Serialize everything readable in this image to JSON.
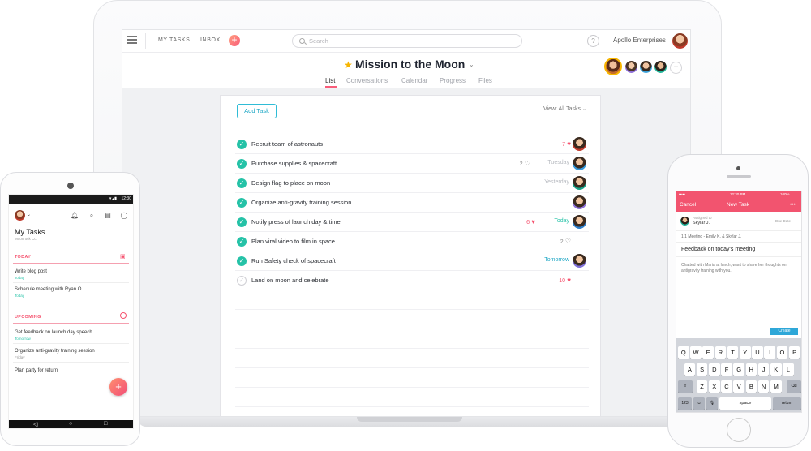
{
  "laptop": {
    "nav": {
      "my_tasks": "MY TASKS",
      "inbox": "INBOX",
      "plus": "+"
    },
    "search_placeholder": "Search",
    "help": "?",
    "org_name": "Apollo Enterprises",
    "project": {
      "title": "Mission to the Moon",
      "tabs": [
        "List",
        "Conversations",
        "Calendar",
        "Progress",
        "Files"
      ],
      "active_tab": "List"
    },
    "member_add": "+",
    "toolbar": {
      "add_task": "Add Task",
      "view_all": "View: All Tasks"
    },
    "tasks": [
      {
        "name": "Recruit team of astronauts",
        "likes": "7",
        "liked": true,
        "due": "",
        "done": true,
        "avatar": "#c0392b"
      },
      {
        "name": "Purchase supplies & spacecraft",
        "likes": "2",
        "liked": false,
        "due": "Tuesday",
        "done": true,
        "avatar": "#3498db"
      },
      {
        "name": "Design flag to place on moon",
        "likes": "",
        "liked": false,
        "due": "Yesterday",
        "done": true,
        "avatar": "#16a085"
      },
      {
        "name": "Organize anti-gravity training session",
        "likes": "",
        "liked": false,
        "due": "",
        "done": true,
        "avatar": "#8e6fd8"
      },
      {
        "name": "Notify press of launch day & time",
        "likes": "6",
        "liked": true,
        "due": "Today",
        "done": true,
        "avatar": "#2d7dc9"
      },
      {
        "name": "Plan viral video to film in space",
        "likes": "2",
        "liked": false,
        "due": "",
        "done": true,
        "avatar": ""
      },
      {
        "name": "Run Safety check of spacecraft",
        "likes": "",
        "liked": false,
        "due": "Tomorrow",
        "done": true,
        "avatar": "#7f6fd8"
      },
      {
        "name": "Land on moon and celebrate",
        "likes": "10",
        "liked": true,
        "due": "",
        "done": false,
        "avatar": ""
      }
    ]
  },
  "android": {
    "time": "12:30",
    "title": "My Tasks",
    "subtitle": "Moonrock Co.",
    "today_label": "TODAY",
    "upcoming_label": "UPCOMING",
    "today_items": [
      {
        "name": "Write blog post",
        "due": "Today"
      },
      {
        "name": "Schedule meeting with Ryan O.",
        "due": "Today"
      }
    ],
    "upcoming_items": [
      {
        "name": "Get feedback on launch day speech",
        "due": "Tomorrow"
      },
      {
        "name": "Organize anti-gravity training session",
        "due": "Friday"
      },
      {
        "name": "Plan party for return",
        "due": ""
      }
    ],
    "fab": "+",
    "nav": {
      "back": "◁",
      "home": "○",
      "recents": "□"
    }
  },
  "iphone": {
    "status_time": "12:30 PM",
    "battery": "100%",
    "cancel": "Cancel",
    "nav_title": "New Task",
    "more": "•••",
    "assigned_to_label": "Assigned to",
    "assignee": "Skylar J.",
    "due_date": "Due Date",
    "meeting": "1:1 Meeting - Emily K. & Skylar J.",
    "task_title": "Feedback on today's meeting",
    "description": "Chatted with Maria at lunch, want to share her thoughts on antigravity training with you.",
    "create": "Create",
    "keyboard": {
      "row1": [
        "Q",
        "W",
        "E",
        "R",
        "T",
        "Y",
        "U",
        "I",
        "O",
        "P"
      ],
      "row2": [
        "A",
        "S",
        "D",
        "F",
        "G",
        "H",
        "J",
        "K",
        "L"
      ],
      "row3": [
        "Z",
        "X",
        "C",
        "V",
        "B",
        "N",
        "M"
      ],
      "numbers": "123",
      "space": "space",
      "return": "return"
    }
  }
}
